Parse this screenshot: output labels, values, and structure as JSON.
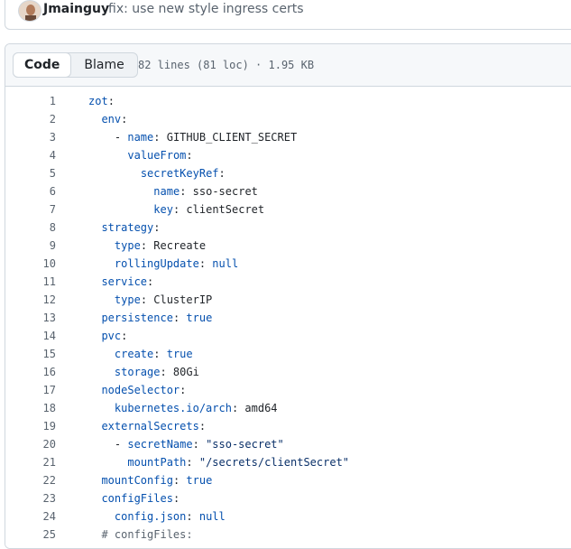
{
  "commit": {
    "author": "Jmainguy",
    "message": "fix: use new style ingress certs"
  },
  "file": {
    "tabs": [
      "Code",
      "Blame"
    ],
    "active_tab": "Code",
    "info": "82 lines (81 loc) · 1.95 KB"
  },
  "code_lines": [
    {
      "n": "1",
      "indent": 0,
      "parts": [
        [
          "k",
          "zot"
        ],
        [
          "p",
          ":"
        ]
      ]
    },
    {
      "n": "2",
      "indent": 2,
      "parts": [
        [
          "k",
          "env"
        ],
        [
          "p",
          ":"
        ]
      ]
    },
    {
      "n": "3",
      "indent": 4,
      "parts": [
        [
          "p",
          "- "
        ],
        [
          "k",
          "name"
        ],
        [
          "p",
          ": GITHUB_CLIENT_SECRET"
        ]
      ]
    },
    {
      "n": "4",
      "indent": 6,
      "parts": [
        [
          "k",
          "valueFrom"
        ],
        [
          "p",
          ":"
        ]
      ]
    },
    {
      "n": "5",
      "indent": 8,
      "parts": [
        [
          "k",
          "secretKeyRef"
        ],
        [
          "p",
          ":"
        ]
      ]
    },
    {
      "n": "6",
      "indent": 10,
      "parts": [
        [
          "k",
          "name"
        ],
        [
          "p",
          ": sso-secret"
        ]
      ]
    },
    {
      "n": "7",
      "indent": 10,
      "parts": [
        [
          "k",
          "key"
        ],
        [
          "p",
          ": clientSecret"
        ]
      ]
    },
    {
      "n": "8",
      "indent": 2,
      "parts": [
        [
          "k",
          "strategy"
        ],
        [
          "p",
          ":"
        ]
      ]
    },
    {
      "n": "9",
      "indent": 4,
      "parts": [
        [
          "k",
          "type"
        ],
        [
          "p",
          ": Recreate"
        ]
      ]
    },
    {
      "n": "10",
      "indent": 4,
      "parts": [
        [
          "k",
          "rollingUpdate"
        ],
        [
          "p",
          ": "
        ],
        [
          "k",
          "null"
        ]
      ]
    },
    {
      "n": "11",
      "indent": 2,
      "parts": [
        [
          "k",
          "service"
        ],
        [
          "p",
          ":"
        ]
      ]
    },
    {
      "n": "12",
      "indent": 4,
      "parts": [
        [
          "k",
          "type"
        ],
        [
          "p",
          ": ClusterIP"
        ]
      ]
    },
    {
      "n": "13",
      "indent": 2,
      "parts": [
        [
          "k",
          "persistence"
        ],
        [
          "p",
          ": "
        ],
        [
          "k",
          "true"
        ]
      ]
    },
    {
      "n": "14",
      "indent": 2,
      "parts": [
        [
          "k",
          "pvc"
        ],
        [
          "p",
          ":"
        ]
      ]
    },
    {
      "n": "15",
      "indent": 4,
      "parts": [
        [
          "k",
          "create"
        ],
        [
          "p",
          ": "
        ],
        [
          "k",
          "true"
        ]
      ]
    },
    {
      "n": "16",
      "indent": 4,
      "parts": [
        [
          "k",
          "storage"
        ],
        [
          "p",
          ": 80Gi"
        ]
      ]
    },
    {
      "n": "17",
      "indent": 2,
      "parts": [
        [
          "k",
          "nodeSelector"
        ],
        [
          "p",
          ":"
        ]
      ]
    },
    {
      "n": "18",
      "indent": 4,
      "parts": [
        [
          "k",
          "kubernetes.io/arch"
        ],
        [
          "p",
          ": amd64"
        ]
      ]
    },
    {
      "n": "19",
      "indent": 2,
      "parts": [
        [
          "k",
          "externalSecrets"
        ],
        [
          "p",
          ":"
        ]
      ]
    },
    {
      "n": "20",
      "indent": 4,
      "parts": [
        [
          "p",
          "- "
        ],
        [
          "k",
          "secretName"
        ],
        [
          "p",
          ": "
        ],
        [
          "s",
          "\"sso-secret\""
        ]
      ]
    },
    {
      "n": "21",
      "indent": 6,
      "parts": [
        [
          "k",
          "mountPath"
        ],
        [
          "p",
          ": "
        ],
        [
          "s",
          "\"/secrets/clientSecret\""
        ]
      ]
    },
    {
      "n": "22",
      "indent": 2,
      "parts": [
        [
          "k",
          "mountConfig"
        ],
        [
          "p",
          ": "
        ],
        [
          "k",
          "true"
        ]
      ]
    },
    {
      "n": "23",
      "indent": 2,
      "parts": [
        [
          "k",
          "configFiles"
        ],
        [
          "p",
          ":"
        ]
      ]
    },
    {
      "n": "24",
      "indent": 4,
      "parts": [
        [
          "k",
          "config.json"
        ],
        [
          "p",
          ": "
        ],
        [
          "k",
          "null"
        ]
      ]
    },
    {
      "n": "25",
      "indent": 2,
      "parts": [
        [
          "c",
          "# configFiles:"
        ]
      ]
    }
  ]
}
